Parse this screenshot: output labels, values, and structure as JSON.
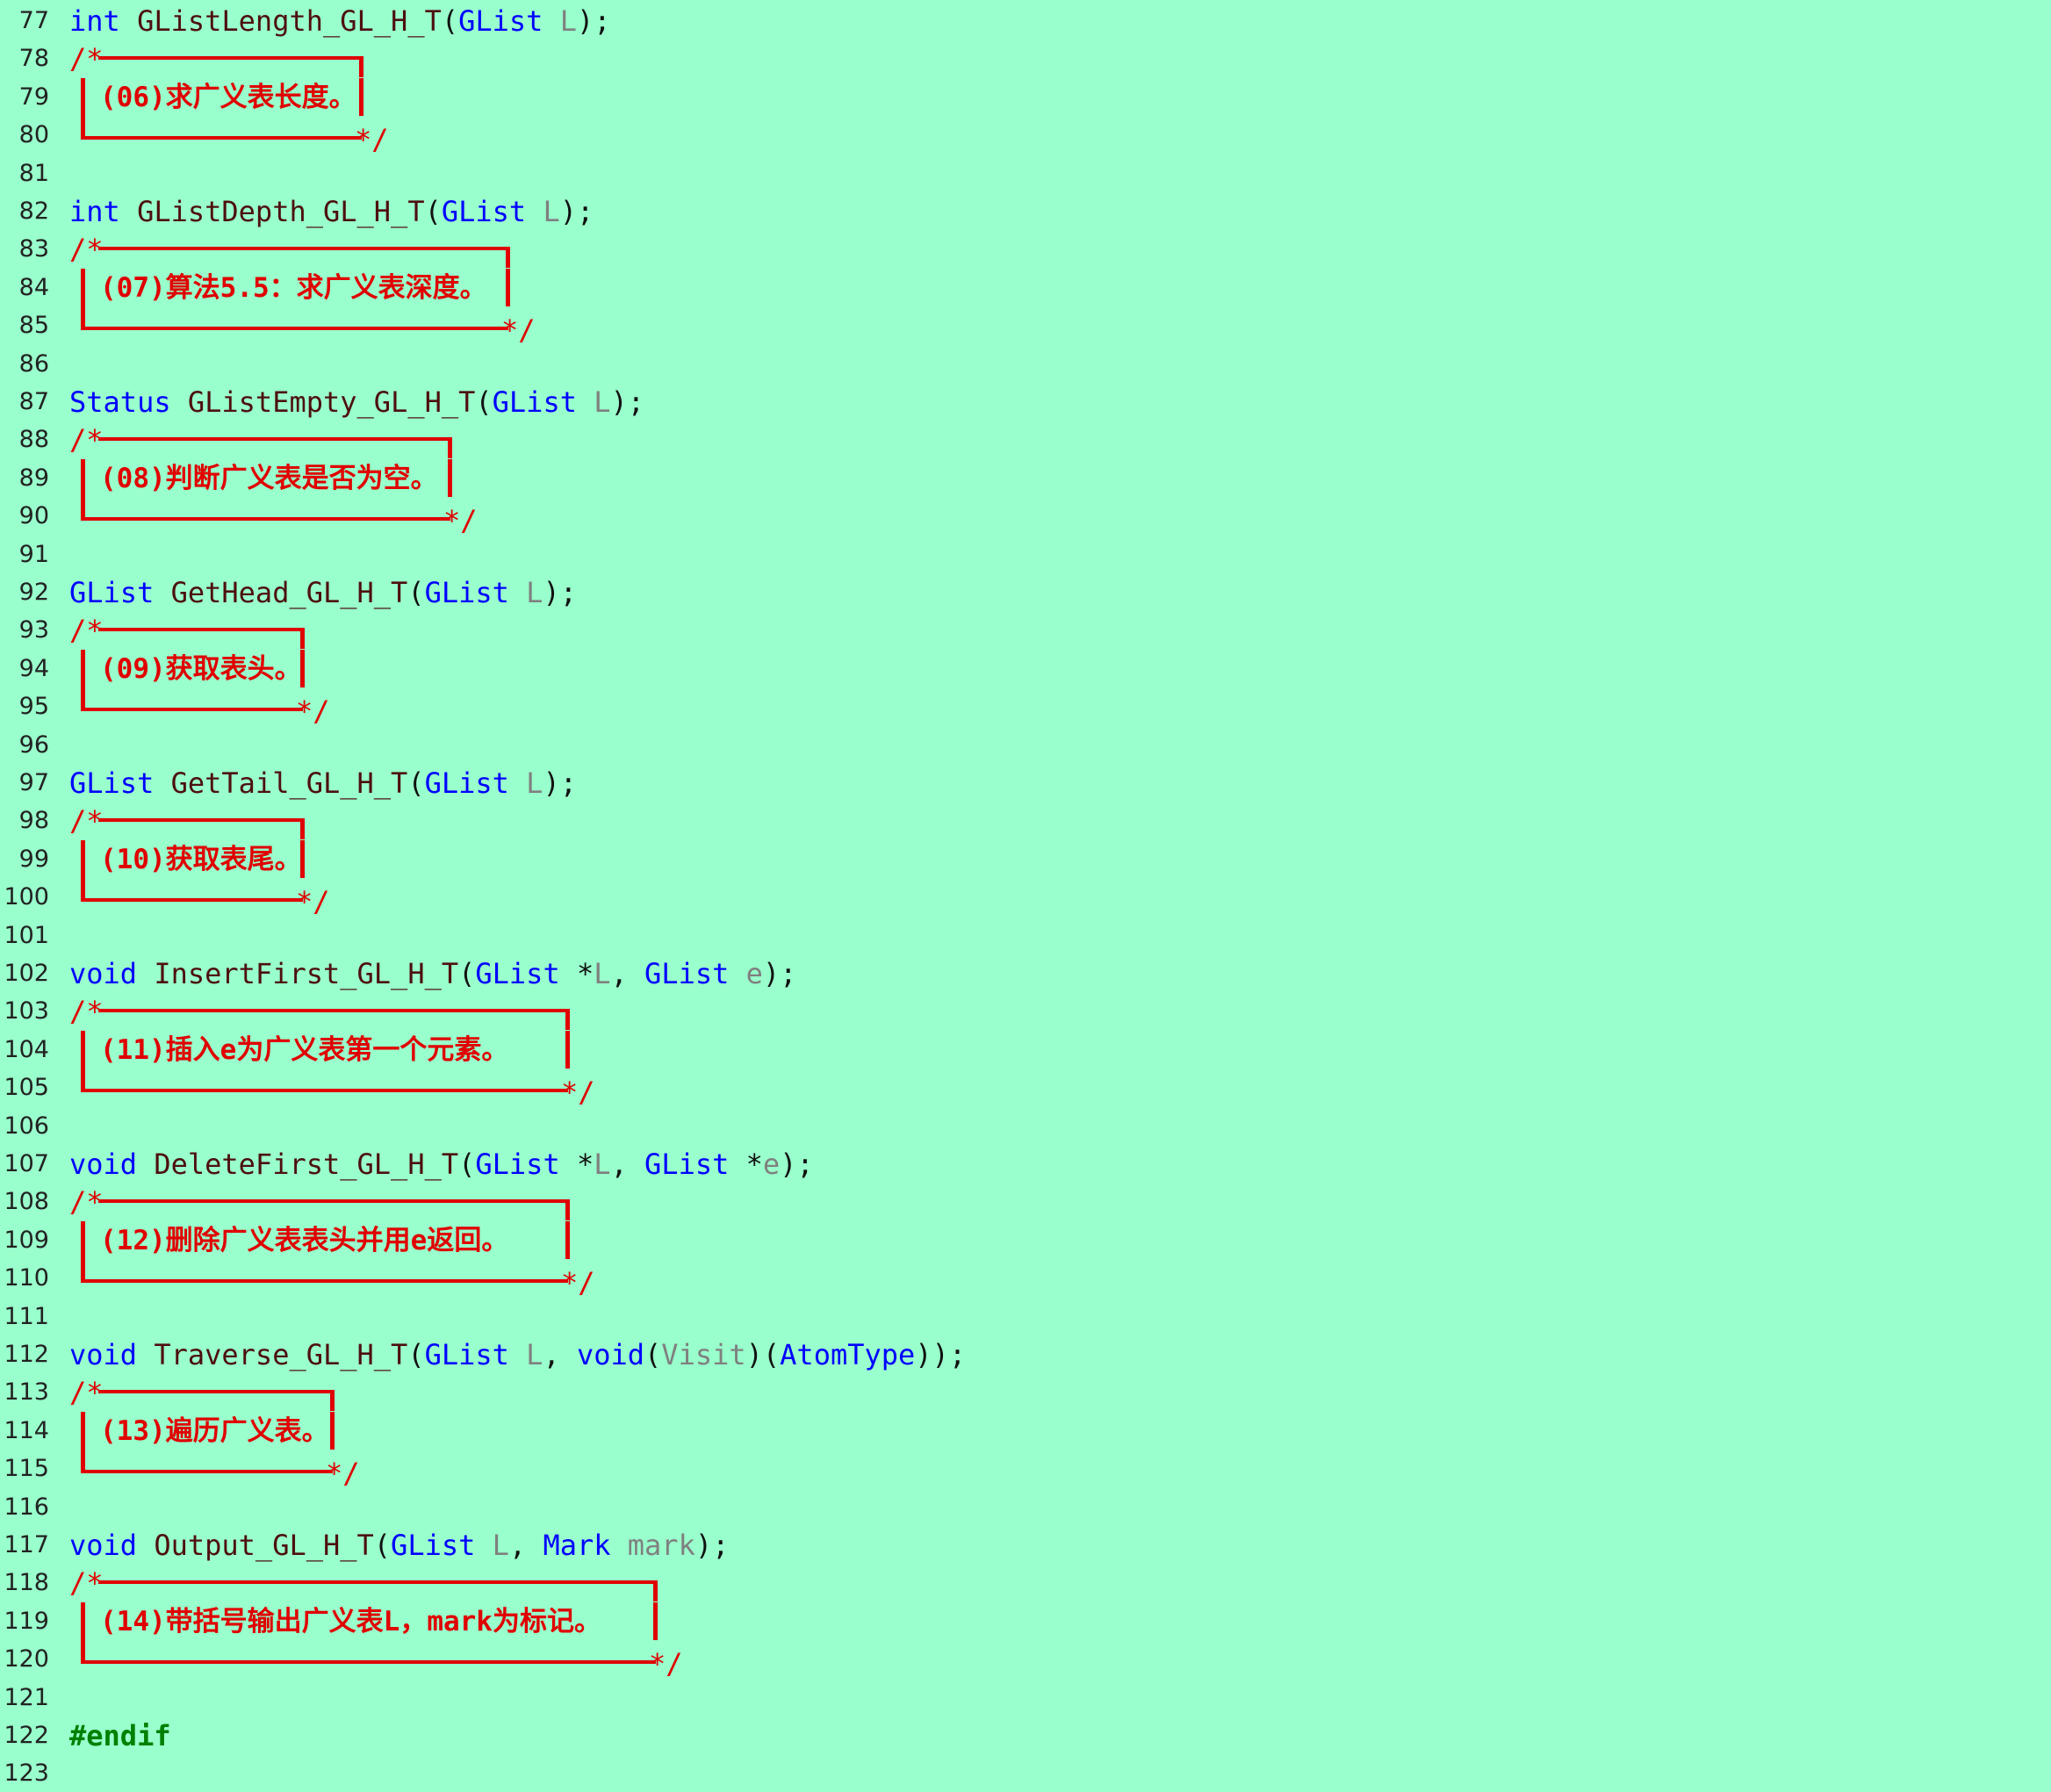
{
  "lines": [
    {
      "n": "77",
      "type": "code",
      "tokens": [
        [
          "kw",
          "int"
        ],
        [
          "pl",
          " "
        ],
        [
          "fn",
          "GListLength_GL_H_T"
        ],
        [
          "punc",
          "("
        ],
        [
          "ty",
          "GList"
        ],
        [
          "pl",
          " "
        ],
        [
          "param",
          "L"
        ],
        [
          "punc",
          ");"
        ]
      ]
    },
    {
      "n": "78",
      "type": "ctop"
    },
    {
      "n": "79",
      "type": "ctext",
      "text": "(06)求广义表长度。"
    },
    {
      "n": "80",
      "type": "cbot"
    },
    {
      "n": "81",
      "type": "blank"
    },
    {
      "n": "82",
      "type": "code",
      "tokens": [
        [
          "kw",
          "int"
        ],
        [
          "pl",
          " "
        ],
        [
          "fn",
          "GListDepth_GL_H_T"
        ],
        [
          "punc",
          "("
        ],
        [
          "ty",
          "GList"
        ],
        [
          "pl",
          " "
        ],
        [
          "param",
          "L"
        ],
        [
          "punc",
          ");"
        ]
      ]
    },
    {
      "n": "83",
      "type": "ctop"
    },
    {
      "n": "84",
      "type": "ctext",
      "text": "(07)算法5.5：求广义表深度。"
    },
    {
      "n": "85",
      "type": "cbot"
    },
    {
      "n": "86",
      "type": "blank"
    },
    {
      "n": "87",
      "type": "code",
      "tokens": [
        [
          "ty",
          "Status"
        ],
        [
          "pl",
          " "
        ],
        [
          "fn",
          "GListEmpty_GL_H_T"
        ],
        [
          "punc",
          "("
        ],
        [
          "ty",
          "GList"
        ],
        [
          "pl",
          " "
        ],
        [
          "param",
          "L"
        ],
        [
          "punc",
          ");"
        ]
      ]
    },
    {
      "n": "88",
      "type": "ctop"
    },
    {
      "n": "89",
      "type": "ctext",
      "text": "(08)判断广义表是否为空。"
    },
    {
      "n": "90",
      "type": "cbot"
    },
    {
      "n": "91",
      "type": "blank"
    },
    {
      "n": "92",
      "type": "code",
      "tokens": [
        [
          "ty",
          "GList"
        ],
        [
          "pl",
          " "
        ],
        [
          "fn",
          "GetHead_GL_H_T"
        ],
        [
          "punc",
          "("
        ],
        [
          "ty",
          "GList"
        ],
        [
          "pl",
          " "
        ],
        [
          "param",
          "L"
        ],
        [
          "punc",
          ");"
        ]
      ]
    },
    {
      "n": "93",
      "type": "ctop"
    },
    {
      "n": "94",
      "type": "ctext",
      "text": "(09)获取表头。"
    },
    {
      "n": "95",
      "type": "cbot"
    },
    {
      "n": "96",
      "type": "blank"
    },
    {
      "n": "97",
      "type": "code",
      "tokens": [
        [
          "ty",
          "GList"
        ],
        [
          "pl",
          " "
        ],
        [
          "fn",
          "GetTail_GL_H_T"
        ],
        [
          "punc",
          "("
        ],
        [
          "ty",
          "GList"
        ],
        [
          "pl",
          " "
        ],
        [
          "param",
          "L"
        ],
        [
          "punc",
          ");"
        ]
      ]
    },
    {
      "n": "98",
      "type": "ctop"
    },
    {
      "n": "99",
      "type": "ctext",
      "text": "(10)获取表尾。"
    },
    {
      "n": "100",
      "type": "cbot"
    },
    {
      "n": "101",
      "type": "blank"
    },
    {
      "n": "102",
      "type": "code",
      "tokens": [
        [
          "kw",
          "void"
        ],
        [
          "pl",
          " "
        ],
        [
          "fn",
          "InsertFirst_GL_H_T"
        ],
        [
          "punc",
          "("
        ],
        [
          "ty",
          "GList"
        ],
        [
          "pl",
          " "
        ],
        [
          "op",
          "*"
        ],
        [
          "param",
          "L"
        ],
        [
          "punc",
          ", "
        ],
        [
          "ty",
          "GList"
        ],
        [
          "pl",
          " "
        ],
        [
          "param",
          "e"
        ],
        [
          "punc",
          ");"
        ]
      ]
    },
    {
      "n": "103",
      "type": "ctop"
    },
    {
      "n": "104",
      "type": "ctext",
      "text": "(11)插入e为广义表第一个元素。"
    },
    {
      "n": "105",
      "type": "cbot"
    },
    {
      "n": "106",
      "type": "blank"
    },
    {
      "n": "107",
      "type": "code",
      "tokens": [
        [
          "kw",
          "void"
        ],
        [
          "pl",
          " "
        ],
        [
          "fn",
          "DeleteFirst_GL_H_T"
        ],
        [
          "punc",
          "("
        ],
        [
          "ty",
          "GList"
        ],
        [
          "pl",
          " "
        ],
        [
          "op",
          "*"
        ],
        [
          "param",
          "L"
        ],
        [
          "punc",
          ", "
        ],
        [
          "ty",
          "GList"
        ],
        [
          "pl",
          " "
        ],
        [
          "op",
          "*"
        ],
        [
          "param",
          "e"
        ],
        [
          "punc",
          ");"
        ]
      ]
    },
    {
      "n": "108",
      "type": "ctop"
    },
    {
      "n": "109",
      "type": "ctext",
      "text": "(12)删除广义表表头并用e返回。"
    },
    {
      "n": "110",
      "type": "cbot"
    },
    {
      "n": "111",
      "type": "blank"
    },
    {
      "n": "112",
      "type": "code",
      "tokens": [
        [
          "kw",
          "void"
        ],
        [
          "pl",
          " "
        ],
        [
          "fn",
          "Traverse_GL_H_T"
        ],
        [
          "punc",
          "("
        ],
        [
          "ty",
          "GList"
        ],
        [
          "pl",
          " "
        ],
        [
          "param",
          "L"
        ],
        [
          "punc",
          ", "
        ],
        [
          "kw",
          "void"
        ],
        [
          "punc",
          "("
        ],
        [
          "param",
          "Visit"
        ],
        [
          "punc",
          ")("
        ],
        [
          "ty",
          "AtomType"
        ],
        [
          "punc",
          "));"
        ]
      ]
    },
    {
      "n": "113",
      "type": "ctop"
    },
    {
      "n": "114",
      "type": "ctext",
      "text": "(13)遍历广义表。"
    },
    {
      "n": "115",
      "type": "cbot"
    },
    {
      "n": "116",
      "type": "blank"
    },
    {
      "n": "117",
      "type": "code",
      "tokens": [
        [
          "kw",
          "void"
        ],
        [
          "pl",
          " "
        ],
        [
          "fn",
          "Output_GL_H_T"
        ],
        [
          "punc",
          "("
        ],
        [
          "ty",
          "GList"
        ],
        [
          "pl",
          " "
        ],
        [
          "param",
          "L"
        ],
        [
          "punc",
          ", "
        ],
        [
          "ty",
          "Mark"
        ],
        [
          "pl",
          " "
        ],
        [
          "param",
          "mark"
        ],
        [
          "punc",
          ");"
        ]
      ]
    },
    {
      "n": "118",
      "type": "ctop"
    },
    {
      "n": "119",
      "type": "ctext",
      "text": "(14)带括号输出广义表L，mark为标记。"
    },
    {
      "n": "120",
      "type": "cbot"
    },
    {
      "n": "121",
      "type": "blank"
    },
    {
      "n": "122",
      "type": "code",
      "tokens": [
        [
          "pre",
          "#endif"
        ]
      ]
    },
    {
      "n": "123",
      "type": "blank"
    }
  ],
  "colors": {
    "background": "#99ffcc",
    "keyword": "#0000ff",
    "function": "#4d0f0f",
    "parameter": "#808080",
    "comment": "#e00000",
    "preprocessor": "#008000"
  },
  "comment_marks": {
    "open": "/*",
    "close": "*/"
  }
}
